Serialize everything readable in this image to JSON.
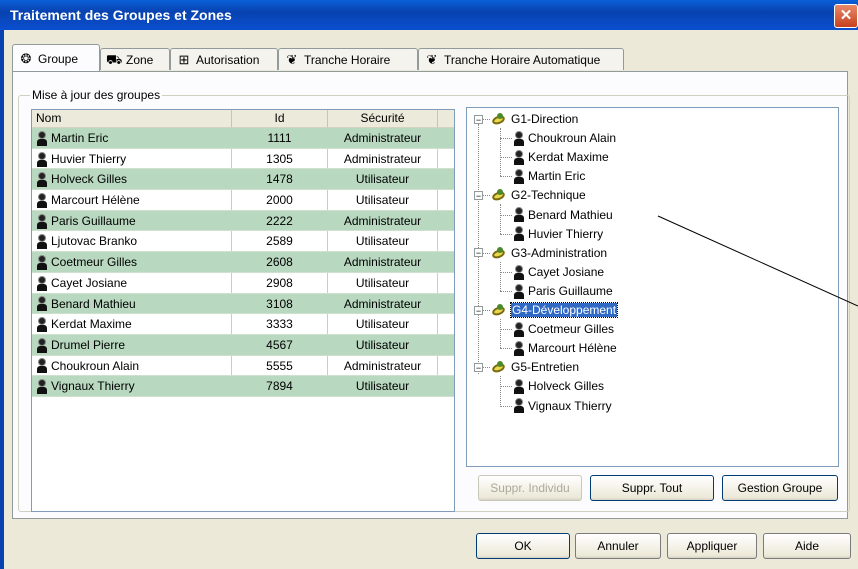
{
  "window": {
    "title": "Traitement des Groupes et Zones",
    "close_glyph": "✕"
  },
  "tabs": [
    {
      "label": "Groupe",
      "icon": "group-icon"
    },
    {
      "label": "Zone",
      "icon": "zone-icon"
    },
    {
      "label": "Autorisation",
      "icon": "door-icon"
    },
    {
      "label": "Tranche Horaire",
      "icon": "schedule-icon"
    },
    {
      "label": "Tranche Horaire Automatique",
      "icon": "auto-schedule-icon"
    }
  ],
  "groupbox_label": "Mise à jour des groupes",
  "list": {
    "headers": {
      "nom": "Nom",
      "id": "Id",
      "securite": "Sécurité"
    },
    "rows": [
      {
        "nom": "Martin Eric",
        "id": "1111",
        "securite": "Administrateur",
        "shade": "green"
      },
      {
        "nom": "Huvier Thierry",
        "id": "1305",
        "securite": "Administrateur",
        "shade": "white"
      },
      {
        "nom": "Holveck Gilles",
        "id": "1478",
        "securite": "Utilisateur",
        "shade": "green"
      },
      {
        "nom": "Marcourt Hélène",
        "id": "2000",
        "securite": "Utilisateur",
        "shade": "white"
      },
      {
        "nom": "Paris Guillaume",
        "id": "2222",
        "securite": "Administrateur",
        "shade": "green"
      },
      {
        "nom": "Ljutovac Branko",
        "id": "2589",
        "securite": "Utilisateur",
        "shade": "white"
      },
      {
        "nom": "Coetmeur Gilles",
        "id": "2608",
        "securite": "Administrateur",
        "shade": "green"
      },
      {
        "nom": "Cayet Josiane",
        "id": "2908",
        "securite": "Utilisateur",
        "shade": "white"
      },
      {
        "nom": "Benard Mathieu",
        "id": "3108",
        "securite": "Administrateur",
        "shade": "green"
      },
      {
        "nom": "Kerdat Maxime",
        "id": "3333",
        "securite": "Utilisateur",
        "shade": "white"
      },
      {
        "nom": "Drumel Pierre",
        "id": "4567",
        "securite": "Utilisateur",
        "shade": "green"
      },
      {
        "nom": "Choukroun Alain",
        "id": "5555",
        "securite": "Administrateur",
        "shade": "white"
      },
      {
        "nom": "Vignaux Thierry",
        "id": "7894",
        "securite": "Utilisateur",
        "shade": "green"
      }
    ]
  },
  "tree": {
    "groups": [
      {
        "label": "G1-Direction",
        "members": [
          "Choukroun Alain",
          "Kerdat Maxime",
          "Martin Eric"
        ]
      },
      {
        "label": "G2-Technique",
        "members": [
          "Benard Mathieu",
          "Huvier Thierry"
        ]
      },
      {
        "label": "G3-Administration",
        "members": [
          "Cayet Josiane",
          "Paris Guillaume"
        ]
      },
      {
        "label": "G4-Développement",
        "members": [
          "Coetmeur Gilles",
          "Marcourt Hélène"
        ],
        "selected": true
      },
      {
        "label": "G5-Entretien",
        "members": [
          "Holveck Gilles",
          "Vignaux Thierry"
        ]
      }
    ],
    "expander_glyph": "−"
  },
  "tree_buttons": {
    "suppr_individu": "Suppr. Individu",
    "suppr_tout": "Suppr. Tout",
    "gestion_groupe": "Gestion Groupe"
  },
  "dialog_buttons": {
    "ok": "OK",
    "annuler": "Annuler",
    "appliquer": "Appliquer",
    "aide": "Aide"
  },
  "colors": {
    "title_bar": "#0a4fd0",
    "row_highlight": "#b8d8c0",
    "selection": "#316ac5"
  }
}
